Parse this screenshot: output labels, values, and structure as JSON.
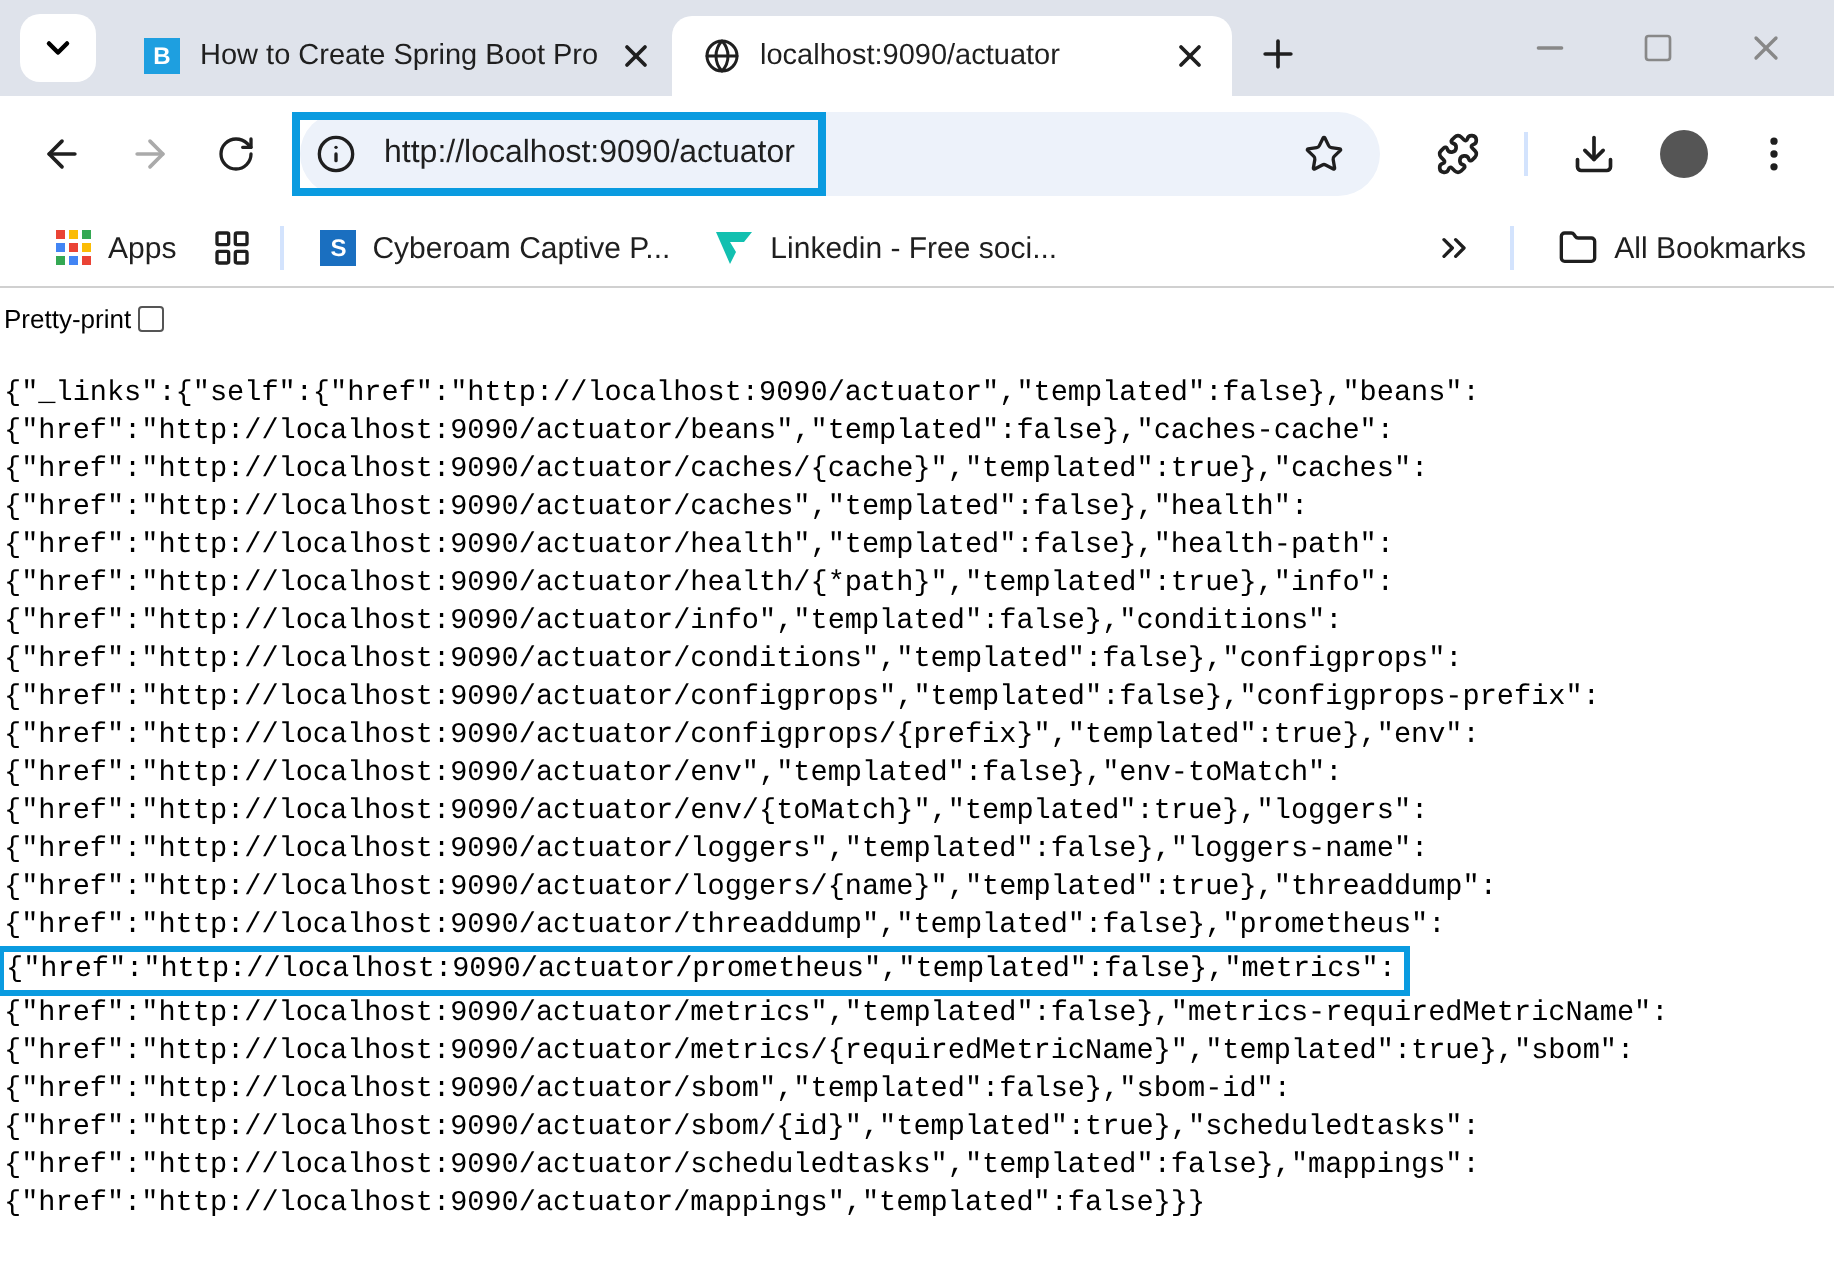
{
  "tabs": [
    {
      "favicon": "B",
      "title": "How to Create Spring Boot Pro",
      "selected": false
    },
    {
      "title": "localhost:9090/actuator",
      "selected": true
    }
  ],
  "address_bar": {
    "url": "http://localhost:9090/actuator",
    "highlighted": true
  },
  "bookmarks": [
    {
      "kind": "apps",
      "label": "Apps"
    },
    {
      "kind": "grid"
    },
    {
      "kind": "site",
      "favicon": "S",
      "label": "Cyberoam Captive P..."
    },
    {
      "kind": "linkedin",
      "label": "Linkedin - Free soci..."
    }
  ],
  "all_bookmarks": "All Bookmarks",
  "pretty_print": {
    "label": "Pretty-print",
    "checked": false
  },
  "json_lines": [
    {
      "text": "{\"_links\":{\"self\":{\"href\":\"http://localhost:9090/actuator\",\"templated\":false},\"beans\":",
      "highlighted": false
    },
    {
      "text": "{\"href\":\"http://localhost:9090/actuator/beans\",\"templated\":false},\"caches-cache\":",
      "highlighted": false
    },
    {
      "text": "{\"href\":\"http://localhost:9090/actuator/caches/{cache}\",\"templated\":true},\"caches\":",
      "highlighted": false
    },
    {
      "text": "{\"href\":\"http://localhost:9090/actuator/caches\",\"templated\":false},\"health\":",
      "highlighted": false
    },
    {
      "text": "{\"href\":\"http://localhost:9090/actuator/health\",\"templated\":false},\"health-path\":",
      "highlighted": false
    },
    {
      "text": "{\"href\":\"http://localhost:9090/actuator/health/{*path}\",\"templated\":true},\"info\":",
      "highlighted": false
    },
    {
      "text": "{\"href\":\"http://localhost:9090/actuator/info\",\"templated\":false},\"conditions\":",
      "highlighted": false
    },
    {
      "text": "{\"href\":\"http://localhost:9090/actuator/conditions\",\"templated\":false},\"configprops\":",
      "highlighted": false
    },
    {
      "text": "{\"href\":\"http://localhost:9090/actuator/configprops\",\"templated\":false},\"configprops-prefix\":",
      "highlighted": false
    },
    {
      "text": "{\"href\":\"http://localhost:9090/actuator/configprops/{prefix}\",\"templated\":true},\"env\":",
      "highlighted": false
    },
    {
      "text": "{\"href\":\"http://localhost:9090/actuator/env\",\"templated\":false},\"env-toMatch\":",
      "highlighted": false
    },
    {
      "text": "{\"href\":\"http://localhost:9090/actuator/env/{toMatch}\",\"templated\":true},\"loggers\":",
      "highlighted": false
    },
    {
      "text": "{\"href\":\"http://localhost:9090/actuator/loggers\",\"templated\":false},\"loggers-name\":",
      "highlighted": false
    },
    {
      "text": "{\"href\":\"http://localhost:9090/actuator/loggers/{name}\",\"templated\":true},\"threaddump\":",
      "highlighted": false
    },
    {
      "text": "{\"href\":\"http://localhost:9090/actuator/threaddump\",\"templated\":false},\"prometheus\":",
      "highlighted": false
    },
    {
      "text": "{\"href\":\"http://localhost:9090/actuator/prometheus\",\"templated\":false},\"metrics\":",
      "highlighted": true
    },
    {
      "text": "{\"href\":\"http://localhost:9090/actuator/metrics\",\"templated\":false},\"metrics-requiredMetricName\":",
      "highlighted": false
    },
    {
      "text": "{\"href\":\"http://localhost:9090/actuator/metrics/{requiredMetricName}\",\"templated\":true},\"sbom\":",
      "highlighted": false
    },
    {
      "text": "{\"href\":\"http://localhost:9090/actuator/sbom\",\"templated\":false},\"sbom-id\":",
      "highlighted": false
    },
    {
      "text": "{\"href\":\"http://localhost:9090/actuator/sbom/{id}\",\"templated\":true},\"scheduledtasks\":",
      "highlighted": false
    },
    {
      "text": "{\"href\":\"http://localhost:9090/actuator/scheduledtasks\",\"templated\":false},\"mappings\":",
      "highlighted": false
    },
    {
      "text": "{\"href\":\"http://localhost:9090/actuator/mappings\",\"templated\":false}}}",
      "highlighted": false
    }
  ]
}
